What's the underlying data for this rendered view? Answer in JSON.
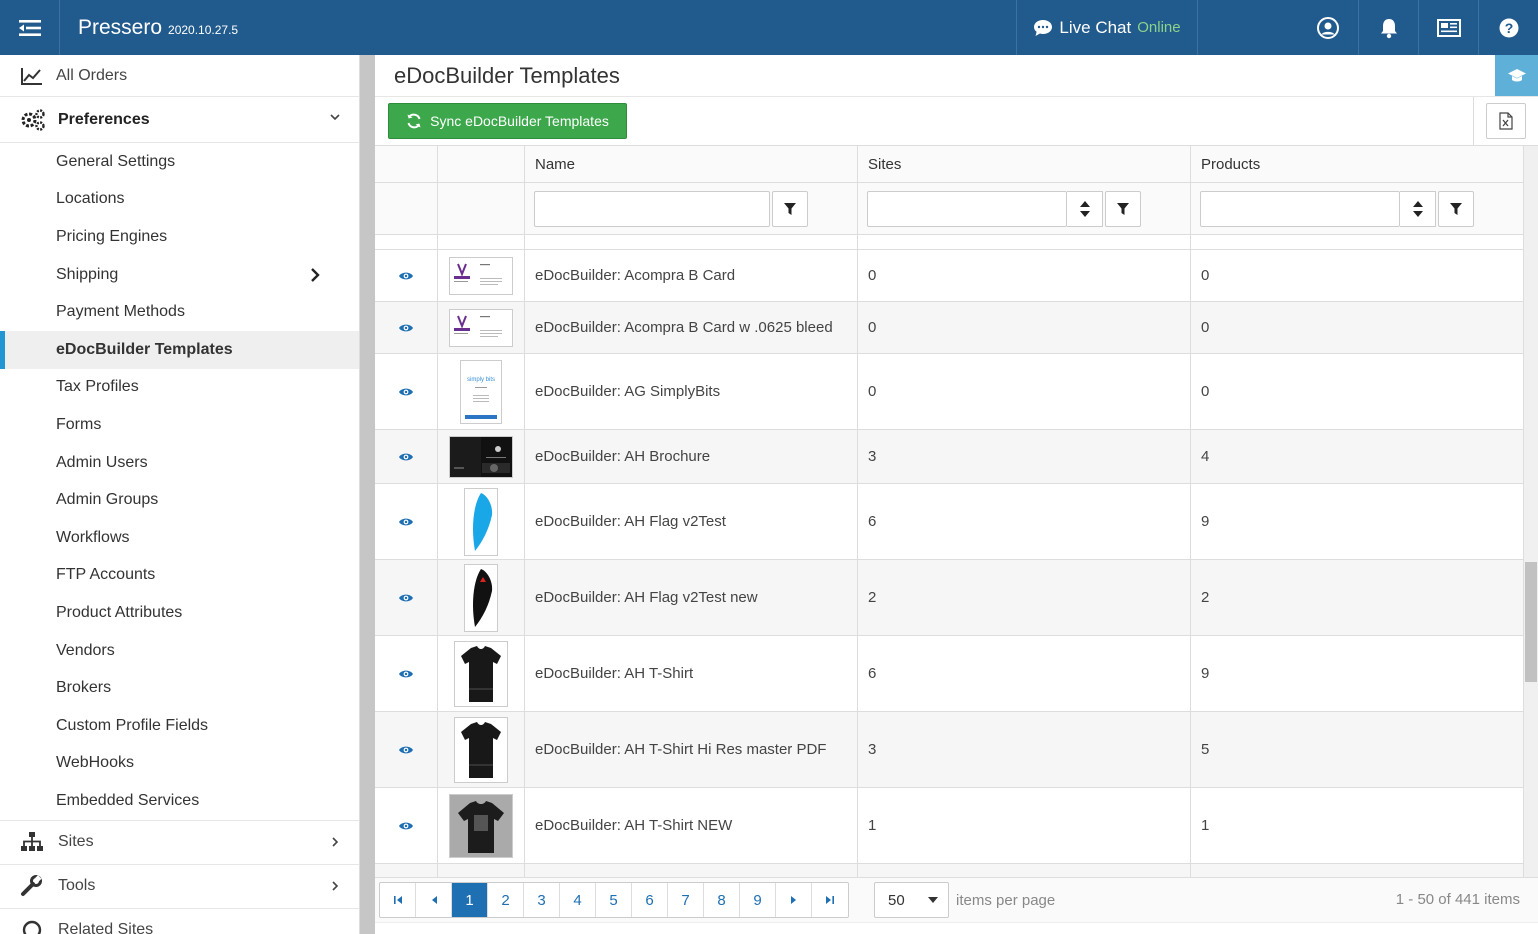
{
  "app": {
    "name": "Pressero",
    "version": "2020.10.27.5"
  },
  "topbar": {
    "live_chat_label": "Live Chat",
    "live_chat_status": "Online"
  },
  "sidebar": {
    "all_orders": "All Orders",
    "preferences": "Preferences",
    "sub_items": [
      "General Settings",
      "Locations",
      "Pricing Engines",
      "Shipping",
      "Payment Methods",
      "eDocBuilder Templates",
      "Tax Profiles",
      "Forms",
      "Admin Users",
      "Admin Groups",
      "Workflows",
      "FTP Accounts",
      "Product Attributes",
      "Vendors",
      "Brokers",
      "Custom Profile Fields",
      "WebHooks",
      "Embedded Services"
    ],
    "active_item": "eDocBuilder Templates",
    "groups": [
      "Sites",
      "Tools",
      "Related Sites"
    ]
  },
  "page": {
    "title": "eDocBuilder Templates",
    "sync_button": "Sync eDocBuilder Templates"
  },
  "grid": {
    "columns": [
      "",
      "",
      "Name",
      "Sites",
      "Products"
    ],
    "rows": [
      {
        "name": "eDocBuilder: Acompra B Card",
        "sites": "0",
        "products": "0",
        "thumb": "card-purple"
      },
      {
        "name": "eDocBuilder: Acompra B Card w .0625 bleed",
        "sites": "0",
        "products": "0",
        "thumb": "card-purple"
      },
      {
        "name": "eDocBuilder: AG SimplyBits",
        "sites": "0",
        "products": "0",
        "thumb": "letter-blue"
      },
      {
        "name": "eDocBuilder: AH Brochure",
        "sites": "3",
        "products": "4",
        "thumb": "brochure-dark"
      },
      {
        "name": "eDocBuilder: AH Flag v2Test",
        "sites": "6",
        "products": "9",
        "thumb": "flag-blue"
      },
      {
        "name": "eDocBuilder: AH Flag v2Test new",
        "sites": "2",
        "products": "2",
        "thumb": "flag-black"
      },
      {
        "name": "eDocBuilder: AH T-Shirt",
        "sites": "6",
        "products": "9",
        "thumb": "tshirt-black"
      },
      {
        "name": "eDocBuilder: AH T-Shirt Hi Res master PDF",
        "sites": "3",
        "products": "5",
        "thumb": "tshirt-black"
      },
      {
        "name": "eDocBuilder: AH T-Shirt NEW",
        "sites": "1",
        "products": "1",
        "thumb": "tshirt-grey"
      }
    ]
  },
  "pager": {
    "pages": [
      "1",
      "2",
      "3",
      "4",
      "5",
      "6",
      "7",
      "8",
      "9"
    ],
    "current": "1",
    "page_size": "50",
    "items_per_page_label": "items per page",
    "info": "1 - 50 of 441 items"
  },
  "colors": {
    "topbar": "#215a8c",
    "accent": "#2196d3",
    "sync_green": "#3ca84b",
    "pager_active": "#1f6fb3"
  }
}
